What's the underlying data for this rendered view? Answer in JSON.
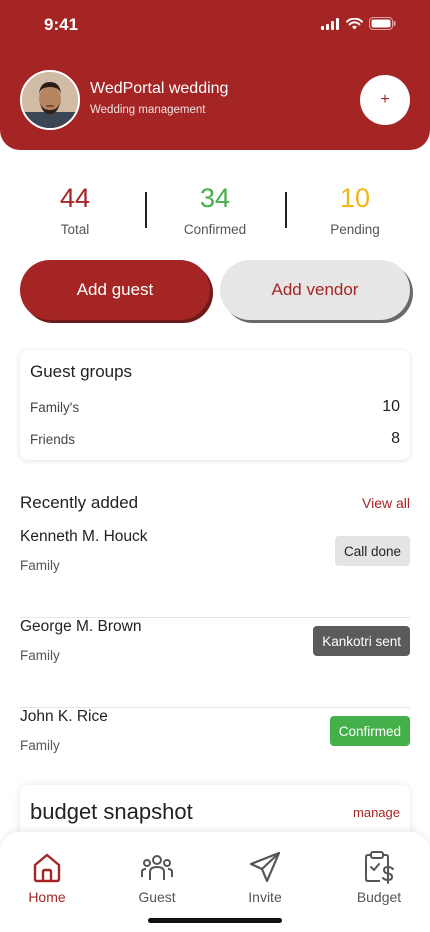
{
  "status_bar": {
    "time": "9:41"
  },
  "header": {
    "title": "WedPortal wedding",
    "subtitle": "Wedding management",
    "plus_label": "+"
  },
  "stats": [
    {
      "value": "44",
      "label": "Total",
      "color": "#A52525"
    },
    {
      "value": "34",
      "label": "Confirmed",
      "color": "#43B049"
    },
    {
      "value": "10",
      "label": "Pending",
      "color": "#F2B51A"
    }
  ],
  "actions": {
    "add_guest": "Add guest",
    "add_vendor": "Add vendor"
  },
  "guest_groups": {
    "title": "Guest groups",
    "items": [
      {
        "name": "Family's",
        "count": "10"
      },
      {
        "name": "Friends",
        "count": "8"
      }
    ]
  },
  "recently_added": {
    "title": "Recently added",
    "view_all": "View all",
    "items": [
      {
        "name": "Kenneth M. Houck",
        "group": "Family",
        "status": "Call done"
      },
      {
        "name": "George M. Brown",
        "group": "Family",
        "status": "Kankotri sent"
      },
      {
        "name": "John K. Rice",
        "group": "Family",
        "status": "Confirmed"
      }
    ]
  },
  "budget": {
    "title": "budget snapshot",
    "link": "manage"
  },
  "nav": [
    {
      "label": "Home",
      "icon": "home-icon",
      "active": true
    },
    {
      "label": "Guest",
      "icon": "guests-icon",
      "active": false
    },
    {
      "label": "Invite",
      "icon": "send-icon",
      "active": false
    },
    {
      "label": "Budget",
      "icon": "budget-clipboard-icon",
      "active": false
    }
  ],
  "colors": {
    "brand": "#A52525",
    "confirmed": "#43B049",
    "pending": "#F2B51A",
    "kankotri": "#5B5B5B"
  }
}
